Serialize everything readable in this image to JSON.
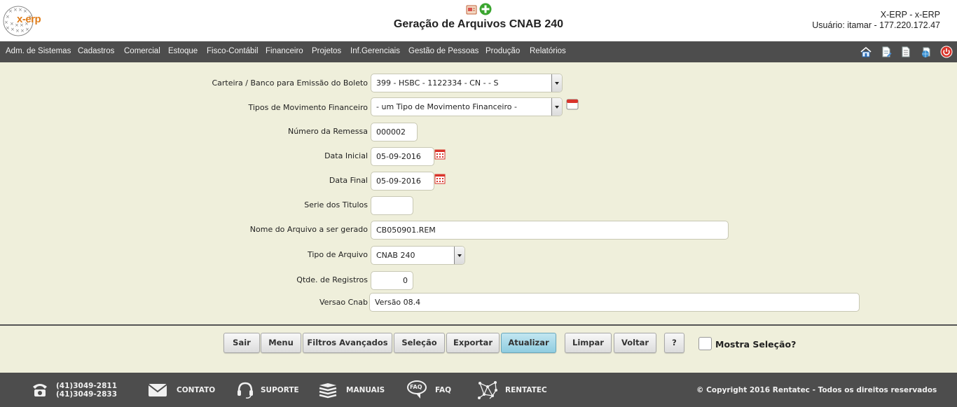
{
  "header": {
    "logo_text": "x-erp",
    "title": "Geração de Arquivos CNAB 240",
    "user_line1": "X-ERP - x-ERP",
    "user_line2": "Usuário: itamar - 177.220.172.47"
  },
  "nav": {
    "items": [
      "Adm. de Sistemas",
      "Cadastros",
      "Comercial",
      "Estoque",
      "Fisco-Contábil",
      "Financeiro",
      "Projetos",
      "Inf.Gerenciais",
      "Gestão de Pessoas",
      "Produção",
      "Relatórios"
    ],
    "icons": [
      "home-icon",
      "document-edit-icon",
      "document-icon",
      "globe-icon",
      "power-icon"
    ]
  },
  "form": {
    "carteira": {
      "label": "Carteira / Banco para Emissão do Boleto",
      "value": "399 - HSBC - 1122334 - CN - - S"
    },
    "tipos_mov": {
      "label": "Tipos de Movimento Financeiro",
      "value": "- um Tipo de Movimento Financeiro -"
    },
    "numero_remessa": {
      "label": "Número da Remessa",
      "value": "000002"
    },
    "data_inicial": {
      "label": "Data Inicial",
      "value": "05-09-2016"
    },
    "data_final": {
      "label": "Data Final",
      "value": "05-09-2016"
    },
    "serie_titulos": {
      "label": "Serie dos Titulos",
      "value": ""
    },
    "nome_arquivo": {
      "label": "Nome do Arquivo a ser gerado",
      "value": "CB050901.REM"
    },
    "tipo_arquivo": {
      "label": "Tipo de Arquivo",
      "value": "CNAB 240"
    },
    "qtde_registros": {
      "label": "Qtde. de Registros",
      "value": "0"
    },
    "versao_cnab": {
      "label": "Versao Cnab",
      "value": "Versão 08.4"
    }
  },
  "buttons": {
    "sair": "Sair",
    "menu": "Menu",
    "filtros": "Filtros Avançados",
    "selecao": "Seleção",
    "exportar": "Exportar",
    "atualizar": "Atualizar",
    "limpar": "Limpar",
    "voltar": "Voltar",
    "help": "?",
    "mostra_selecao": "Mostra Seleção?"
  },
  "footer": {
    "phone1": "(41)3049-2811",
    "phone2": "(41)3049-2833",
    "contato": "CONTATO",
    "suporte": "SUPORTE",
    "manuais": "MANUAIS",
    "faq": "FAQ",
    "faq_icon_text": "FAQ",
    "rentatec": "RENTATEC",
    "copyright": "© Copyright 2016 Rentatec - Todos os direitos reservados"
  },
  "colors": {
    "background": "#efefdb",
    "nav_bar": "#4d4d4d",
    "active_button": "#a9dbe9",
    "logo_orange": "#e07d1a",
    "add_green": "#3aa52f"
  }
}
